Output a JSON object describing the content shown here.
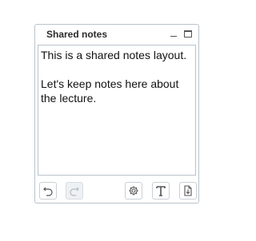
{
  "panel": {
    "title": "Shared notes",
    "header_icons": [
      "minimize-icon",
      "maximize-icon"
    ]
  },
  "notes": {
    "lines": [
      "This is a shared notes layout.",
      "",
      "Let's keep notes here about",
      "the lecture."
    ]
  },
  "toolbar": {
    "icons": [
      "undo-icon",
      "redo-icon",
      "settings-icon",
      "font-icon",
      "export-icon"
    ],
    "redo_disabled": true
  },
  "colors": {
    "border": "#b9c3cc",
    "text": "#111111",
    "icon": "#555555"
  }
}
